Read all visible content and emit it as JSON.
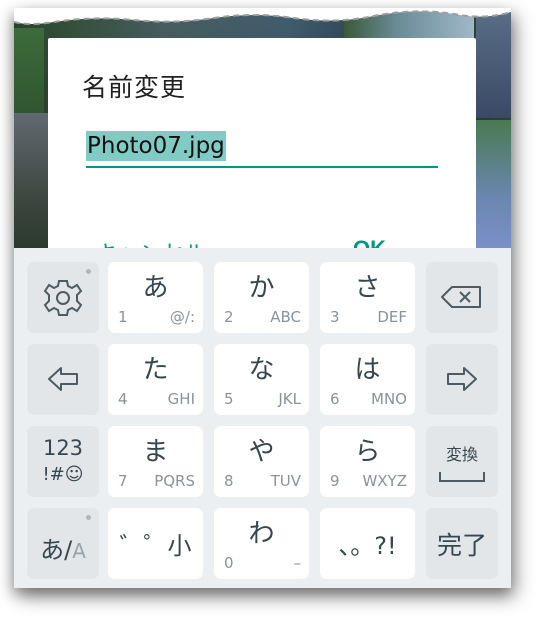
{
  "dialog": {
    "title": "名前変更",
    "input_value": "Photo07.jpg",
    "cancel_label": "キャンセル",
    "ok_label": "OK"
  },
  "keyboard": {
    "rows": [
      {
        "center": [
          {
            "main": "あ",
            "num": "1",
            "sub": "@/:"
          },
          {
            "main": "か",
            "num": "2",
            "sub": "ABC"
          },
          {
            "main": "さ",
            "num": "3",
            "sub": "DEF"
          }
        ]
      },
      {
        "center": [
          {
            "main": "た",
            "num": "4",
            "sub": "GHI"
          },
          {
            "main": "な",
            "num": "5",
            "sub": "JKL"
          },
          {
            "main": "は",
            "num": "6",
            "sub": "MNO"
          }
        ]
      },
      {
        "center": [
          {
            "main": "ま",
            "num": "7",
            "sub": "PQRS"
          },
          {
            "main": "や",
            "num": "8",
            "sub": "TUV"
          },
          {
            "main": "ら",
            "num": "9",
            "sub": "WXYZ"
          }
        ]
      },
      {
        "center": [
          {
            "main": "゛゜小",
            "num": "",
            "sub": ""
          },
          {
            "main": "わ",
            "num": "0",
            "sub": "–"
          },
          {
            "main": "、。?!",
            "num": "",
            "sub": ""
          }
        ]
      }
    ],
    "left": {
      "settings_icon": "gear-icon",
      "left_arrow_icon": "left-arrow-icon",
      "symbols_line1": "123",
      "symbols_line2": "!#☺",
      "mode_label_a": "あ/",
      "mode_label_b": "A"
    },
    "right": {
      "backspace_icon": "backspace-icon",
      "right_arrow_icon": "right-arrow-icon",
      "convert_label": "変換",
      "space_icon": "space-icon",
      "done_label": "完了"
    }
  },
  "colors": {
    "accent": "#009688",
    "selection": "#80cbc4",
    "keyboard_bg": "#eceff1",
    "key_bg": "#ffffff",
    "side_key_bg": "#e3e6e8"
  }
}
